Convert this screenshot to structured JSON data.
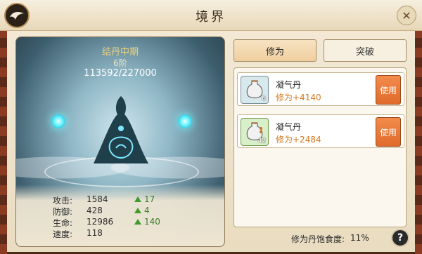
{
  "header": {
    "title": "境界"
  },
  "realm": {
    "name": "结丹中期",
    "step": "6阶",
    "progress": "113592/227000"
  },
  "stats": [
    {
      "label": "攻击:",
      "value": "1584",
      "inc": "17"
    },
    {
      "label": "防御:",
      "value": "428",
      "inc": "4"
    },
    {
      "label": "生命:",
      "value": "12986",
      "inc": "140"
    },
    {
      "label": "速度:",
      "value": "118"
    }
  ],
  "tabs": [
    {
      "label": "修为",
      "active": true
    },
    {
      "label": "突破",
      "active": false
    }
  ],
  "items": [
    {
      "name": "凝气丹",
      "effect": "修为+4140",
      "count": "6",
      "button": "使用",
      "icon": "potion-bottle-icon"
    },
    {
      "name": "凝气丹",
      "effect": "修为+2484",
      "count": "42",
      "button": "使用",
      "icon": "potion-bottle-icon"
    }
  ],
  "footer": {
    "satiety_label": "修为丹饱食度:",
    "satiety_value": "11%",
    "help": "?"
  },
  "colors": {
    "accent_orange": "#e06a2b",
    "effect_orange": "#d6781e",
    "realm_gold": "#f1d37a",
    "inc_green": "#3b7d2a"
  }
}
